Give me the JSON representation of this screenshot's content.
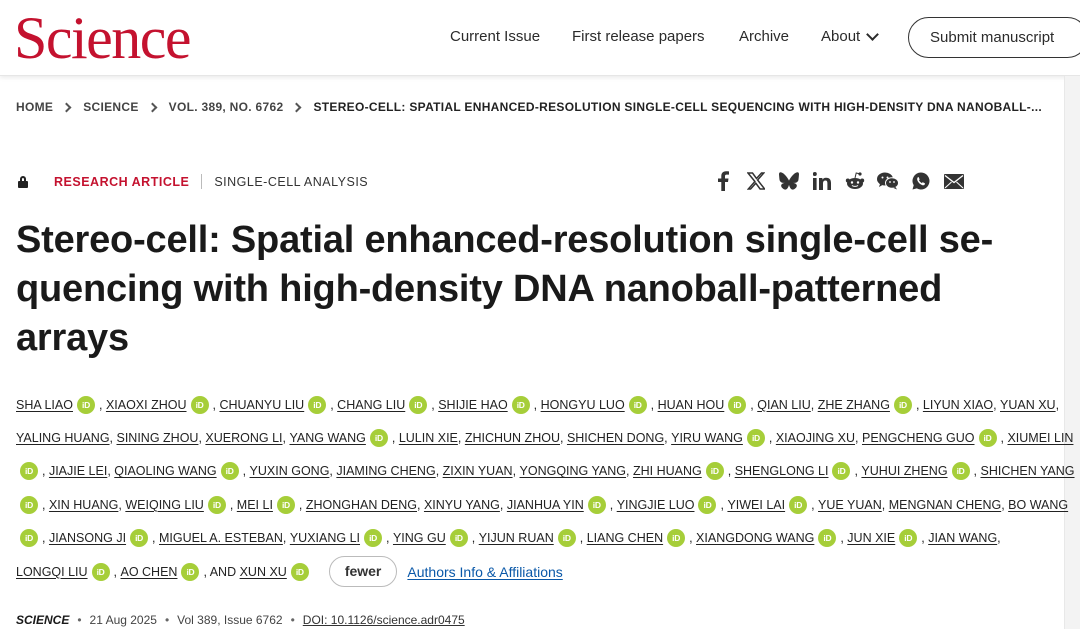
{
  "header": {
    "logo": "Science",
    "nav": {
      "current_issue": "Current Issue",
      "first_release": "First release papers",
      "archive": "Archive",
      "about": "About"
    },
    "submit": "Submit manuscript"
  },
  "breadcrumb": [
    "HOME",
    "SCIENCE",
    "VOL. 389, NO. 6762",
    "STEREO-CELL: SPATIAL ENHANCED-RESOLUTION SINGLE-CELL SEQUENCING WITH HIGH-DENSITY DNA NANOBALL-..."
  ],
  "article": {
    "type": "RESEARCH ARTICLE",
    "subject": "SINGLE-CELL ANALYSIS",
    "title_lines": [
      "Stereo-cell: Spatial enhanced-resolution single-cell se-",
      "quencing with high-density DNA nanoball-patterned",
      "arrays"
    ]
  },
  "share_icons": [
    "facebook-icon",
    "x-icon",
    "bluesky-icon",
    "linkedin-icon",
    "reddit-icon",
    "wechat-icon",
    "whatsapp-icon",
    "email-icon"
  ],
  "orcid_label": "iD",
  "author_lines": [
    [
      {
        "name": "SHA LIAO",
        "orcid": true
      },
      {
        "sep": ", "
      },
      {
        "name": "XIAOXI ZHOU",
        "orcid": true
      },
      {
        "sep": ", "
      },
      {
        "name": "CHUANYU LIU",
        "orcid": true
      },
      {
        "sep": ", "
      },
      {
        "name": "CHANG LIU",
        "orcid": true
      },
      {
        "sep": ", "
      },
      {
        "name": "SHIJIE HAO",
        "orcid": true
      },
      {
        "sep": ", "
      },
      {
        "name": "HONGYU LUO",
        "orcid": true
      },
      {
        "sep": ", "
      },
      {
        "name": "HUAN HOU",
        "orcid": true
      },
      {
        "sep": ", "
      },
      {
        "name": "QIAN LIU",
        "orcid": false
      },
      {
        "sep": ", "
      },
      {
        "name": "ZHE ZHANG",
        "orcid": true
      },
      {
        "sep": ", "
      },
      {
        "name": "LIYUN XIAO",
        "orcid": false
      },
      {
        "sep": ", "
      },
      {
        "name": "YUAN XU",
        "orcid": false
      },
      {
        "sep": ","
      }
    ],
    [
      {
        "name": "YALING HUANG",
        "orcid": false
      },
      {
        "sep": ", "
      },
      {
        "name": "SINING ZHOU",
        "orcid": false
      },
      {
        "sep": ", "
      },
      {
        "name": "XUERONG LI",
        "orcid": false
      },
      {
        "sep": ", "
      },
      {
        "name": "YANG WANG",
        "orcid": true
      },
      {
        "sep": ", "
      },
      {
        "name": "LULIN XIE",
        "orcid": false
      },
      {
        "sep": ", "
      },
      {
        "name": "ZHICHUN ZHOU",
        "orcid": false
      },
      {
        "sep": ", "
      },
      {
        "name": "SHICHEN DONG",
        "orcid": false
      },
      {
        "sep": ", "
      },
      {
        "name": "YIRU WANG",
        "orcid": true
      },
      {
        "sep": ", "
      },
      {
        "name": "XIAOJING XU",
        "orcid": false
      },
      {
        "sep": ", "
      },
      {
        "name": "PENGCHENG GUO",
        "orcid": true
      },
      {
        "sep": ", "
      },
      {
        "name": "XIUMEI LIN",
        "orcid": false
      }
    ],
    [
      {
        "lead_orcid": true
      },
      {
        "sep": ", "
      },
      {
        "name": "JIAJIE LEI",
        "orcid": false
      },
      {
        "sep": ", "
      },
      {
        "name": "QIAOLING WANG",
        "orcid": true
      },
      {
        "sep": ", "
      },
      {
        "name": "YUXIN GONG",
        "orcid": false
      },
      {
        "sep": ", "
      },
      {
        "name": "JIAMING CHENG",
        "orcid": false
      },
      {
        "sep": ", "
      },
      {
        "name": "ZIXIN YUAN",
        "orcid": false
      },
      {
        "sep": ", "
      },
      {
        "name": "YONGQING YANG",
        "orcid": false
      },
      {
        "sep": ", "
      },
      {
        "name": "ZHI HUANG",
        "orcid": true
      },
      {
        "sep": ", "
      },
      {
        "name": "SHENGLONG LI",
        "orcid": true
      },
      {
        "sep": ", "
      },
      {
        "name": "YUHUI ZHENG",
        "orcid": true
      },
      {
        "sep": ", "
      },
      {
        "name": "SHICHEN YANG",
        "orcid": false
      }
    ],
    [
      {
        "lead_orcid": true
      },
      {
        "sep": ", "
      },
      {
        "name": "XIN HUANG",
        "orcid": false
      },
      {
        "sep": ", "
      },
      {
        "name": "WEIQING LIU",
        "orcid": true
      },
      {
        "sep": ", "
      },
      {
        "name": "MEI LI",
        "orcid": true
      },
      {
        "sep": ", "
      },
      {
        "name": "ZHONGHAN DENG",
        "orcid": false
      },
      {
        "sep": ", "
      },
      {
        "name": "XINYU YANG",
        "orcid": false
      },
      {
        "sep": ", "
      },
      {
        "name": "JIANHUA YIN",
        "orcid": true
      },
      {
        "sep": ", "
      },
      {
        "name": "YINGJIE LUO",
        "orcid": true
      },
      {
        "sep": ", "
      },
      {
        "name": "YIWEI LAI",
        "orcid": true
      },
      {
        "sep": ", "
      },
      {
        "name": "YUE YUAN",
        "orcid": false
      },
      {
        "sep": ", "
      },
      {
        "name": "MENGNAN CHENG",
        "orcid": false
      },
      {
        "sep": ", "
      },
      {
        "name": "BO WANG",
        "orcid": false
      }
    ],
    [
      {
        "lead_orcid": true
      },
      {
        "sep": ", "
      },
      {
        "name": "JIANSONG JI",
        "orcid": true
      },
      {
        "sep": ", "
      },
      {
        "name": "MIGUEL A. ESTEBAN",
        "orcid": false
      },
      {
        "sep": ", "
      },
      {
        "name": "YUXIANG LI",
        "orcid": true
      },
      {
        "sep": ", "
      },
      {
        "name": "YING GU",
        "orcid": true
      },
      {
        "sep": ", "
      },
      {
        "name": "YIJUN RUAN",
        "orcid": true
      },
      {
        "sep": ", "
      },
      {
        "name": "LIANG CHEN",
        "orcid": true
      },
      {
        "sep": ", "
      },
      {
        "name": "XIANGDONG WANG",
        "orcid": true
      },
      {
        "sep": ", "
      },
      {
        "name": "JUN XIE",
        "orcid": true
      },
      {
        "sep": ", "
      },
      {
        "name": "JIAN WANG",
        "orcid": false
      },
      {
        "sep": ","
      }
    ],
    [
      {
        "name": "LONGQI LIU",
        "orcid": true
      },
      {
        "sep": ", "
      },
      {
        "name": "AO CHEN",
        "orcid": true
      },
      {
        "sep": ", AND "
      },
      {
        "name": "XUN XU",
        "orcid": true
      }
    ]
  ],
  "fewer_button": "fewer",
  "affiliations_link": "Authors Info & Affiliations",
  "citation": {
    "journal": "SCIENCE",
    "date": "21 Aug 2025",
    "volume_issue": "Vol 389, Issue 6762",
    "doi": "DOI: 10.1126/science.adr0475"
  },
  "colors": {
    "brand_red": "#c4122f",
    "orcid_green": "#a6ce39",
    "link_blue": "#0a58a8"
  }
}
